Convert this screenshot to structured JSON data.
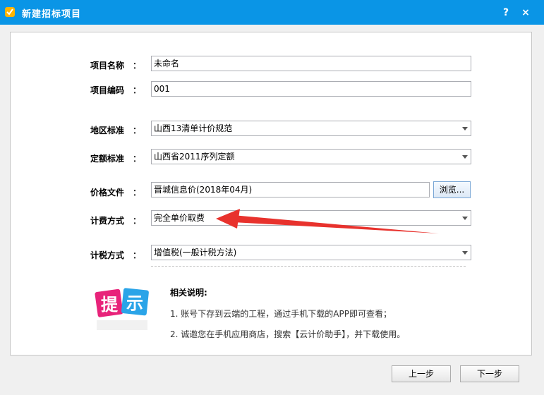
{
  "window": {
    "title": "新建招标项目",
    "help_label": "?",
    "close_label": "×"
  },
  "form": {
    "project_name": {
      "label": "项目名称",
      "value": "未命名"
    },
    "project_code": {
      "label": "项目编码",
      "value": "001"
    },
    "region_standard": {
      "label": "地区标准",
      "value": "山西13清单计价规范"
    },
    "quota_standard": {
      "label": "定额标准",
      "value": "山西省2011序列定额"
    },
    "price_file": {
      "label": "价格文件",
      "value": "晋城信息价(2018年04月)",
      "browse_label": "浏览..."
    },
    "fee_method": {
      "label": "计费方式",
      "value": "完全单价取费"
    },
    "tax_method": {
      "label": "计税方式",
      "value": "增值税(一般计税方法)"
    },
    "colon": "："
  },
  "tips": {
    "badge_text_1": "提",
    "badge_text_2": "示",
    "title": "相关说明:",
    "items": [
      "1. 账号下存到云端的工程，通过手机下载的APP即可查看；",
      "2. 诚邀您在手机应用商店，搜索【云计价助手】，并下载使用。"
    ]
  },
  "footer": {
    "prev_label": "上一步",
    "next_label": "下一步"
  },
  "colors": {
    "titlebar": "#0a95e6",
    "annotation_arrow": "#e8322d"
  }
}
